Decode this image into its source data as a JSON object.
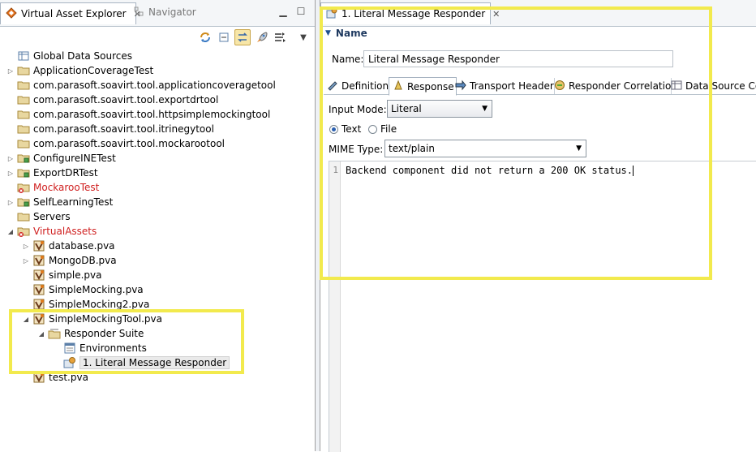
{
  "left_panel": {
    "tabs": [
      {
        "label": "Virtual Asset Explorer",
        "icon": "diamond-icon",
        "active": true
      },
      {
        "label": "Navigator",
        "icon": "navigator-icon",
        "active": false
      }
    ],
    "tree": [
      {
        "label": "Global Data Sources",
        "icon": "data-source-icon",
        "level": 0,
        "expander": "none",
        "color": "#000000"
      },
      {
        "label": "ApplicationCoverageTest",
        "icon": "folder-icon",
        "level": 0,
        "expander": "collapsed",
        "color": "#000000"
      },
      {
        "label": "com.parasoft.soavirt.tool.applicationcoveragetool",
        "icon": "folder-icon",
        "level": 0,
        "expander": "none",
        "color": "#000000"
      },
      {
        "label": "com.parasoft.soavirt.tool.exportdrtool",
        "icon": "folder-icon",
        "level": 0,
        "expander": "none",
        "color": "#000000"
      },
      {
        "label": "com.parasoft.soavirt.tool.httpsimplemockingtool",
        "icon": "folder-icon",
        "level": 0,
        "expander": "none",
        "color": "#000000"
      },
      {
        "label": "com.parasoft.soavirt.tool.itrinegytool",
        "icon": "folder-icon",
        "level": 0,
        "expander": "none",
        "color": "#000000"
      },
      {
        "label": "com.parasoft.soavirt.tool.mockarootool",
        "icon": "folder-icon",
        "level": 0,
        "expander": "none",
        "color": "#000000"
      },
      {
        "label": "ConfigureINETest",
        "icon": "project-icon",
        "level": 0,
        "expander": "collapsed",
        "color": "#000000"
      },
      {
        "label": "ExportDRTest",
        "icon": "project-icon",
        "level": 0,
        "expander": "collapsed",
        "color": "#000000"
      },
      {
        "label": "MockarooTest",
        "icon": "project-error-icon",
        "level": 0,
        "expander": "none",
        "color": "#d02020"
      },
      {
        "label": "SelfLearningTest",
        "icon": "project-icon",
        "level": 0,
        "expander": "collapsed",
        "color": "#000000"
      },
      {
        "label": "Servers",
        "icon": "folder-icon",
        "level": 0,
        "expander": "none",
        "color": "#000000"
      },
      {
        "label": "VirtualAssets",
        "icon": "project-error-icon",
        "level": 0,
        "expander": "expanded",
        "color": "#d02020"
      },
      {
        "label": "database.pva",
        "icon": "pva-icon",
        "level": 1,
        "expander": "collapsed",
        "color": "#000000"
      },
      {
        "label": "MongoDB.pva",
        "icon": "pva-icon",
        "level": 1,
        "expander": "collapsed",
        "color": "#000000"
      },
      {
        "label": "simple.pva",
        "icon": "pva-icon",
        "level": 1,
        "expander": "none",
        "color": "#000000"
      },
      {
        "label": "SimpleMocking.pva",
        "icon": "pva-icon",
        "level": 1,
        "expander": "none",
        "color": "#000000"
      },
      {
        "label": "SimpleMocking2.pva",
        "icon": "pva-icon",
        "level": 1,
        "expander": "none",
        "color": "#000000"
      },
      {
        "label": "SimpleMockingTool.pva",
        "icon": "pva-icon",
        "level": 1,
        "expander": "expanded",
        "color": "#000000"
      },
      {
        "label": "Responder Suite",
        "icon": "suite-icon",
        "level": 2,
        "expander": "expanded",
        "color": "#000000"
      },
      {
        "label": "Environments",
        "icon": "environments-icon",
        "level": 3,
        "expander": "none",
        "color": "#000000"
      },
      {
        "label": "1. Literal Message Responder",
        "icon": "responder-icon",
        "level": 3,
        "expander": "none",
        "color": "#000000",
        "selected": true
      },
      {
        "label": "test.pva",
        "icon": "pva-icon",
        "level": 1,
        "expander": "none",
        "color": "#000000"
      }
    ]
  },
  "editor": {
    "tab_label": "1. Literal Message Responder",
    "section_title": "Name",
    "name_label": "Name:",
    "name_value": "Literal Message Responder",
    "subtabs": [
      {
        "label": "Definition",
        "icon": "definition-icon"
      },
      {
        "label": "Response",
        "icon": "response-icon",
        "active": true
      },
      {
        "label": "Transport Header",
        "icon": "transport-icon"
      },
      {
        "label": "Responder Correlation",
        "icon": "correlation-icon"
      },
      {
        "label": "Data Source Cor",
        "icon": "data-source-icon"
      }
    ],
    "input_mode_label": "Input Mode:",
    "input_mode_value": "Literal",
    "radio_text": "Text",
    "radio_file": "File",
    "mime_label": "MIME Type:",
    "mime_value": "text/plain",
    "line_number": "1",
    "body_text": "Backend component did not return a 200 OK status."
  },
  "colors": {
    "highlight": "#f2ea4d",
    "error_text": "#d02020"
  }
}
